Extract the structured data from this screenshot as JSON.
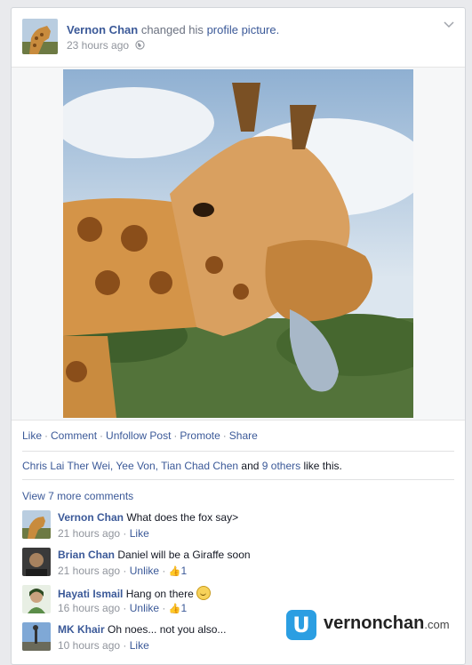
{
  "post": {
    "author": "Vernon Chan",
    "action_text": "changed his",
    "object_link": "profile picture.",
    "timestamp": "23 hours ago",
    "privacy_icon": "globe-icon",
    "menu_icon": "chevron-down-icon"
  },
  "actions": {
    "like": "Like",
    "comment": "Comment",
    "unfollow": "Unfollow Post",
    "promote": "Promote",
    "share": "Share",
    "separator": "·"
  },
  "likes": {
    "names": "Chris Lai Ther Wei, Yee Von, Tian Chad Chen",
    "conjunction": "and",
    "others": "9 others",
    "suffix": "like this."
  },
  "view_more": "View 7 more comments",
  "comments": [
    {
      "name": "Vernon Chan",
      "text": "What does the fox say>",
      "time": "21 hours ago",
      "action": "Like",
      "likes": ""
    },
    {
      "name": "Brian Chan",
      "text": "Daniel will be a Giraffe soon",
      "time": "21 hours ago",
      "action": "Unlike",
      "likes": "1"
    },
    {
      "name": "Hayati Ismail",
      "text": "Hang on there",
      "time": "16 hours ago",
      "action": "Unlike",
      "likes": "1"
    },
    {
      "name": "MK Khair",
      "text": "Oh noes... not you also...",
      "time": "10 hours ago",
      "action": "Like",
      "likes": ""
    }
  ],
  "watermark": {
    "logo_letter": "U",
    "brand": "vernonchan",
    "domain": ".com"
  },
  "colors": {
    "link": "#3b5998",
    "muted": "#90949c",
    "brand": "#2b9ee2"
  }
}
